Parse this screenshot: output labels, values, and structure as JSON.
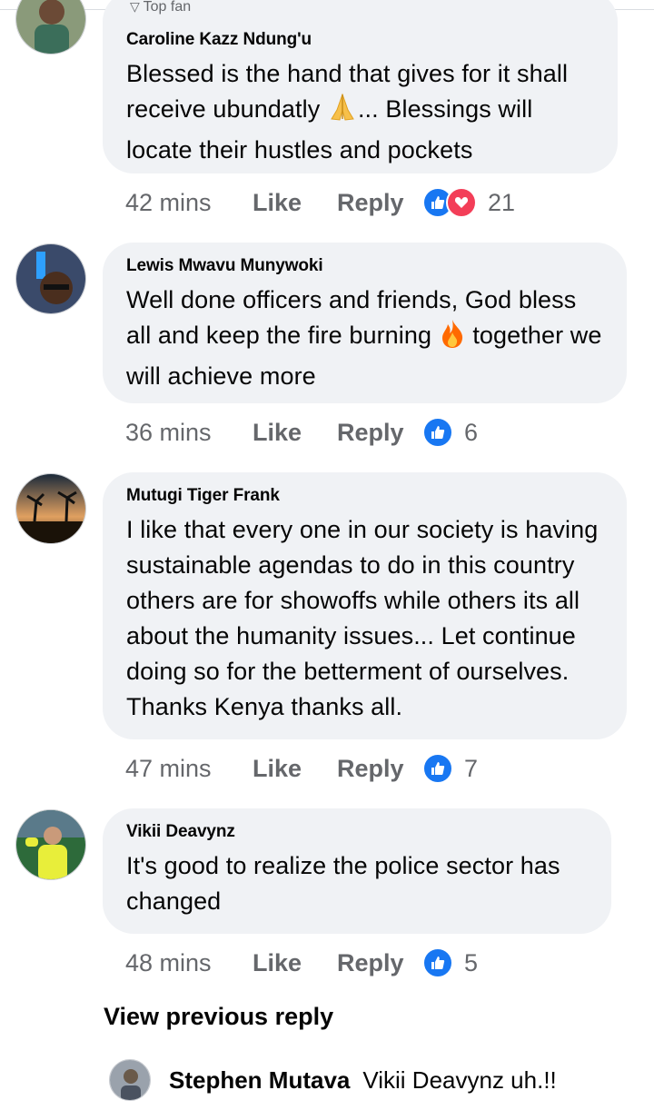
{
  "partial_badge": "Top fan",
  "comments": [
    {
      "name": "Caroline Kazz Ndung'u",
      "text_parts": [
        "Blessed is the hand that gives for it shall receive ubundatly ",
        "... Blessings will locate their hustles and pockets"
      ],
      "emoji": "folded-hands",
      "time": "42 mins",
      "like": "Like",
      "reply": "Reply",
      "reactions": [
        "like-icon",
        "love-icon"
      ],
      "count": "21"
    },
    {
      "name": "Lewis Mwavu Munywoki",
      "text_parts": [
        "Well done officers and friends, God bless all and keep the fire burning ",
        " together we will achieve more"
      ],
      "emoji": "fire",
      "time": "36 mins",
      "like": "Like",
      "reply": "Reply",
      "reactions": [
        "like-icon"
      ],
      "count": "6"
    },
    {
      "name": "Mutugi Tiger Frank",
      "text_parts": [
        "I like that every one in our society is having sustainable agendas to do in this country others are for showoffs while others its all about the humanity issues... Let continue doing so for the betterment of ourselves. Thanks Kenya thanks all."
      ],
      "time": "47 mins",
      "like": "Like",
      "reply": "Reply",
      "reactions": [
        "like-icon"
      ],
      "count": "7"
    },
    {
      "name": "Vikii Deavynz",
      "text_parts": [
        "It's good to realize the police sector has changed"
      ],
      "time": "48 mins",
      "like": "Like",
      "reply": "Reply",
      "reactions": [
        "like-icon"
      ],
      "count": "5"
    }
  ],
  "view_previous": "View previous reply",
  "last_reply": {
    "name": "Stephen Mutava",
    "text": "Vikii Deavynz uh.!!"
  },
  "colors": {
    "bubble": "#f0f2f5",
    "like_blue": "#1877f2",
    "love_red": "#f33e58",
    "meta_gray": "#65676b"
  }
}
